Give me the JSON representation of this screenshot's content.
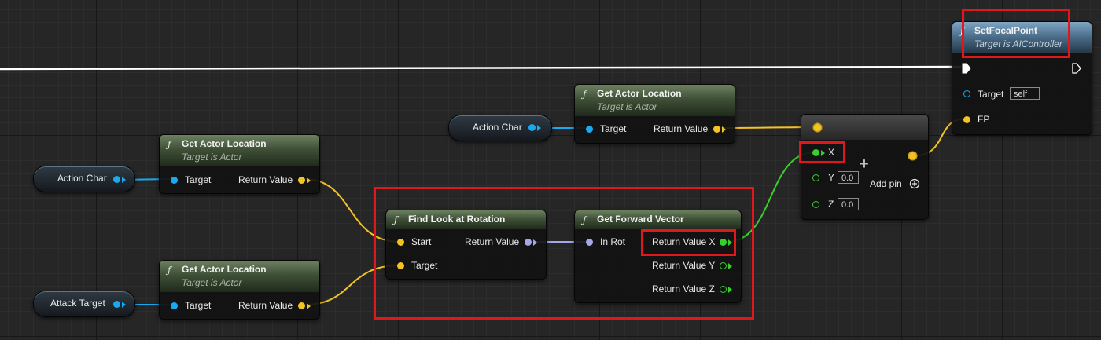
{
  "colors": {
    "highlight": "#e0181e",
    "object_pin": "#1aa8ef",
    "vector_pin": "#f3c322",
    "rotator_pin": "#a5a8e8",
    "float_pin": "#36d02d",
    "exec_wire": "#ffffff"
  },
  "icons": {
    "function": "function-icon",
    "add_pin": "add-pin-icon",
    "exec": "exec-pin-icon"
  },
  "nodes": {
    "get_loc_1": {
      "glyph": "ƒ",
      "title": "Get Actor Location",
      "subtitle": "Target is Actor",
      "in_label": "Target",
      "out_label": "Return Value"
    },
    "get_loc_2": {
      "glyph": "ƒ",
      "title": "Get Actor Location",
      "subtitle": "Target is Actor",
      "in_label": "Target",
      "out_label": "Return Value"
    },
    "get_loc_3": {
      "glyph": "ƒ",
      "title": "Get Actor Location",
      "subtitle": "Target is Actor",
      "in_label": "Target",
      "out_label": "Return Value"
    },
    "find_look": {
      "glyph": "ƒ",
      "title": "Find Look at Rotation",
      "start_label": "Start",
      "target_label": "Target",
      "out_label": "Return Value"
    },
    "forward": {
      "glyph": "ƒ",
      "title": "Get Forward Vector",
      "in_label": "In Rot",
      "out_x": "Return Value X",
      "out_y": "Return Value Y",
      "out_z": "Return Value Z"
    },
    "make_vec": {
      "x_label": "X",
      "y_label": "Y",
      "z_label": "Z",
      "y_value": "0.0",
      "z_value": "0.0",
      "add_pin_label": "Add pin",
      "plus": "+"
    },
    "set_focal": {
      "glyph": "ƒ",
      "title": "SetFocalPoint",
      "subtitle": "Target is AIController",
      "target_label": "Target",
      "target_value": "self",
      "fp_label": "FP"
    }
  },
  "variables": {
    "action_char_top": "Action Char",
    "action_char_left": "Action Char",
    "attack_target": "Attack Target"
  }
}
